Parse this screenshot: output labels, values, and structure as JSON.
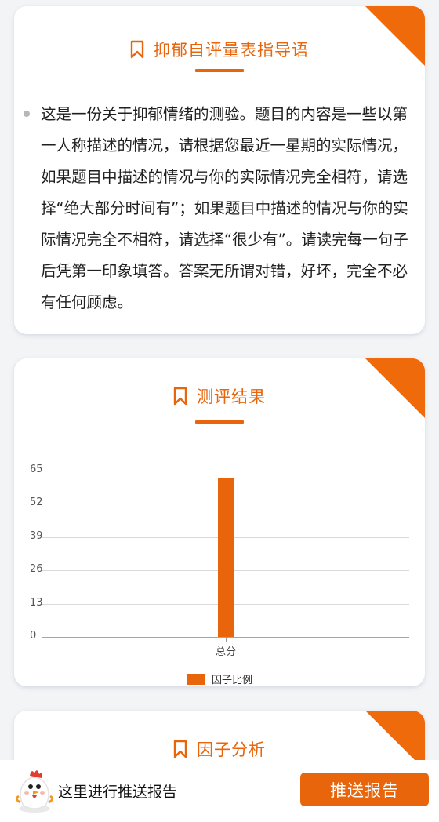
{
  "guide_card": {
    "title": "抑郁自评量表指导语",
    "text": "这是一份关于抑郁情绪的测验。题目的内容是一些以第一人称描述的情况，请根据您最近一星期的实际情况，如果题目中描述的情况与你的实际情况完全相符，请选择“绝大部分时间有”；如果题目中描述的情况与你的实际情况完全不相符，请选择“很少有”。请读完每一句子后凭第一印象填答。答案无所谓对错，好坏，完全不必有任何顾虑。"
  },
  "result_card": {
    "title": "测评结果"
  },
  "chart_data": {
    "type": "bar",
    "categories": [
      "总分"
    ],
    "series": [
      {
        "name": "因子比例",
        "values": [
          62
        ]
      }
    ],
    "yticks": [
      0,
      13,
      26,
      39,
      52,
      65
    ],
    "ylim": [
      0,
      65
    ],
    "grid": true,
    "legend": "bottom",
    "color": "#e8650b"
  },
  "factor_card": {
    "title": "因子分析"
  },
  "bottom_bar": {
    "prompt": "这里进行推送报告",
    "button_label": "推送报告"
  },
  "colors": {
    "accent": "#e8650b",
    "background": "#f3f4f6"
  },
  "icons": {
    "title_icon": "bookmark-icon",
    "mascot": "chicken-mascot-icon"
  }
}
